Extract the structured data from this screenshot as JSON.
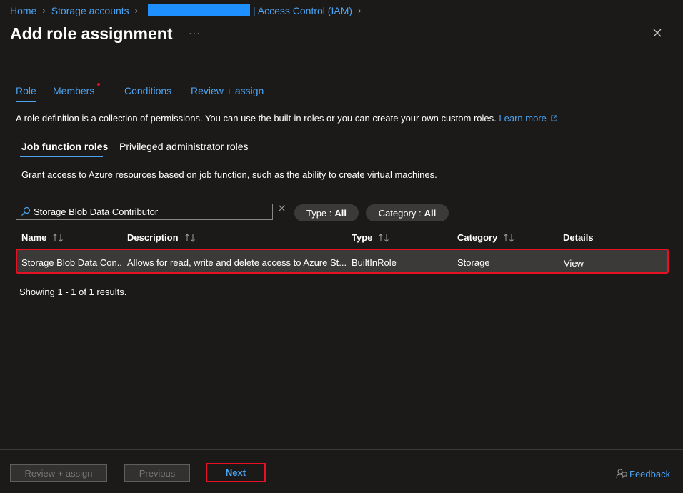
{
  "breadcrumb": {
    "home": "Home",
    "storage_accounts": "Storage accounts",
    "iam": "| Access Control (IAM)"
  },
  "page": {
    "title": "Add role assignment",
    "more": "···"
  },
  "tabs": [
    {
      "label": "Role"
    },
    {
      "label": "Members"
    },
    {
      "label": "Conditions"
    },
    {
      "label": "Review + assign"
    }
  ],
  "intro": {
    "text": "A role definition is a collection of permissions. You can use the built-in roles or you can create your own custom roles.",
    "learn_more": "Learn more"
  },
  "subtabs": [
    {
      "label": "Job function roles"
    },
    {
      "label": "Privileged administrator roles"
    }
  ],
  "grant_text": "Grant access to Azure resources based on job function, such as the ability to create virtual machines.",
  "search": {
    "value": "Storage Blob Data Contributor"
  },
  "filters": {
    "type_label": "Type :",
    "type_value": "All",
    "category_label": "Category :",
    "category_value": "All"
  },
  "table": {
    "headers": {
      "name": "Name",
      "description": "Description",
      "type": "Type",
      "category": "Category",
      "details": "Details"
    },
    "rows": [
      {
        "name": "Storage Blob Data Con...",
        "description": "Allows for read, write and delete access to Azure St...",
        "type": "BuiltInRole",
        "category": "Storage",
        "details": "View"
      }
    ],
    "showing": "Showing 1 - 1 of 1 results."
  },
  "footer": {
    "review_assign": "Review + assign",
    "previous": "Previous",
    "next": "Next",
    "feedback": "Feedback"
  },
  "colors": {
    "accent": "#4ca3f0",
    "highlight": "#e81123",
    "background": "#1b1a19"
  }
}
